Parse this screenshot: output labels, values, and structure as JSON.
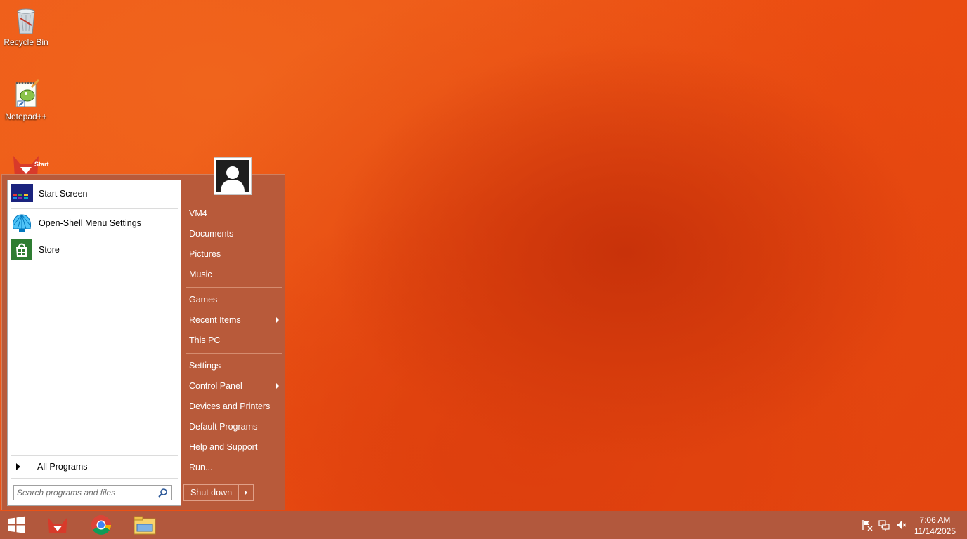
{
  "desktop": {
    "icons": [
      {
        "label": "Recycle Bin",
        "icon": "recycle-bin-icon"
      },
      {
        "label": "Notepad++",
        "icon": "notepad-plus-plus-icon"
      },
      {
        "label": "",
        "icon": "app-fox-icon"
      }
    ]
  },
  "start_menu": {
    "pinned": [
      {
        "label": "Start Screen",
        "icon": "start-screen-icon",
        "icon_text": "Start"
      },
      {
        "label": "Open-Shell Menu Settings",
        "icon": "shell-icon"
      },
      {
        "label": "Store",
        "icon": "store-icon"
      }
    ],
    "all_programs": "All Programs",
    "search": {
      "placeholder": "Search programs and files"
    },
    "right_items_group1": [
      "VM4",
      "Documents",
      "Pictures",
      "Music"
    ],
    "right_items_group2": [
      {
        "label": "Games",
        "submenu": false
      },
      {
        "label": "Recent Items",
        "submenu": true
      },
      {
        "label": "This PC",
        "submenu": false
      }
    ],
    "right_items_group3": [
      {
        "label": "Settings",
        "submenu": false
      },
      {
        "label": "Control Panel",
        "submenu": true
      },
      {
        "label": "Devices and Printers",
        "submenu": false
      },
      {
        "label": "Default Programs",
        "submenu": false
      },
      {
        "label": "Help and Support",
        "submenu": false
      },
      {
        "label": "Run...",
        "submenu": false
      }
    ],
    "shutdown_label": "Shut down"
  },
  "taskbar": {
    "pinned": [
      "windows-logo-icon",
      "app-fox-icon",
      "chrome-icon",
      "file-explorer-icon"
    ],
    "tray": [
      "action-center-flag-icon",
      "network-icon",
      "volume-muted-icon"
    ],
    "time": "7:06 AM",
    "date": "11/14/2025"
  },
  "colors": {
    "accent": "#b85a3a",
    "taskbar": "#b2583d",
    "wallpaper": "#ee5a1a"
  }
}
